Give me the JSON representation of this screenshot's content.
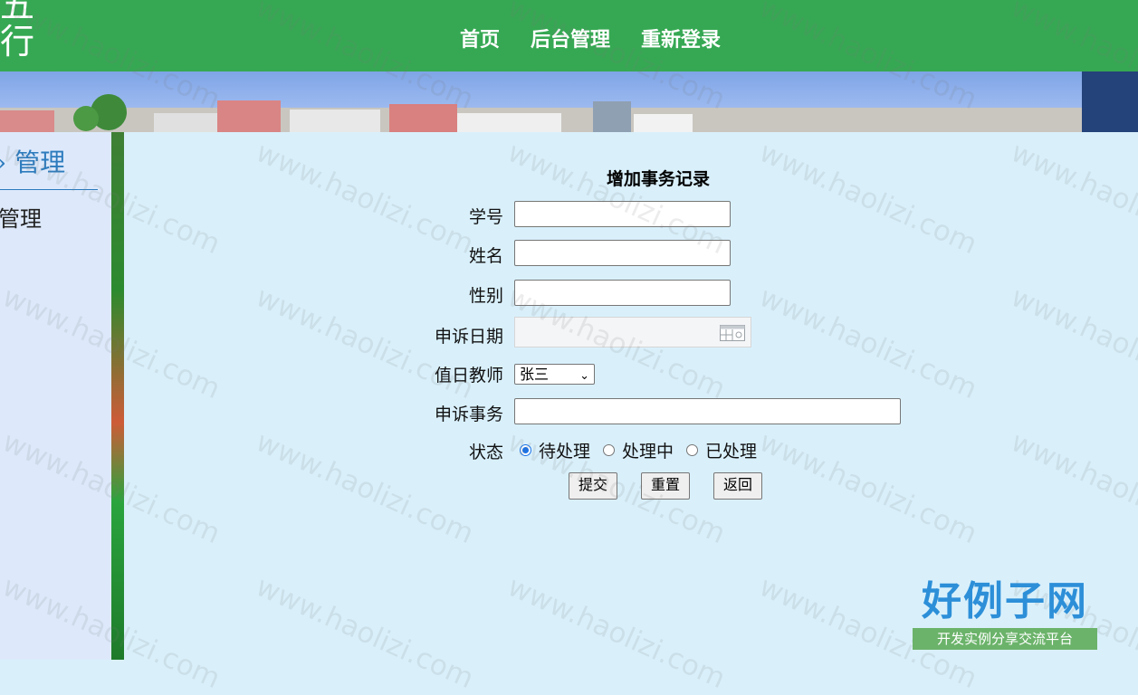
{
  "header": {
    "brand_line1": "五",
    "brand_line2": "行"
  },
  "nav": {
    "home": "首页",
    "admin": "后台管理",
    "relogin": "重新登录"
  },
  "sidebar": {
    "heading": "管理",
    "item": "管理"
  },
  "form": {
    "title": "增加事务记录",
    "labels": {
      "student_id": "学号",
      "name": "姓名",
      "gender": "性别",
      "date": "申诉日期",
      "teacher": "值日教师",
      "matter": "申诉事务",
      "status": "状态"
    },
    "teacher_selected": "张三",
    "status_options": [
      "待处理",
      "处理中",
      "已处理"
    ],
    "buttons": {
      "submit": "提交",
      "reset": "重置",
      "back": "返回"
    }
  },
  "watermark": "www.haolizi.com",
  "logo": {
    "title": "好例子网",
    "subtitle": "开发实例分享交流平台"
  },
  "colors": {
    "header": "#36a853",
    "panel": "#d9f0fb",
    "radio_accent": "#1a73e8"
  }
}
